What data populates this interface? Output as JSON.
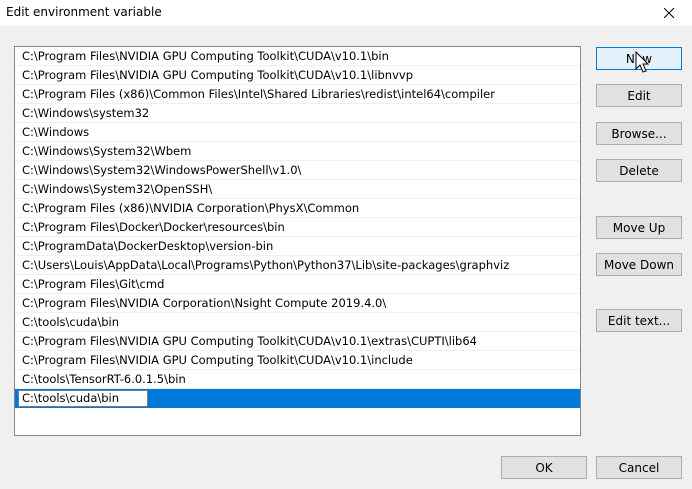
{
  "window": {
    "title": "Edit environment variable"
  },
  "entries": [
    "C:\\Program Files\\NVIDIA GPU Computing Toolkit\\CUDA\\v10.1\\bin",
    "C:\\Program Files\\NVIDIA GPU Computing Toolkit\\CUDA\\v10.1\\libnvvp",
    "C:\\Program Files (x86)\\Common Files\\Intel\\Shared Libraries\\redist\\intel64\\compiler",
    "C:\\Windows\\system32",
    "C:\\Windows",
    "C:\\Windows\\System32\\Wbem",
    "C:\\Windows\\System32\\WindowsPowerShell\\v1.0\\",
    "C:\\Windows\\System32\\OpenSSH\\",
    "C:\\Program Files (x86)\\NVIDIA Corporation\\PhysX\\Common",
    "C:\\Program Files\\Docker\\Docker\\resources\\bin",
    "C:\\ProgramData\\DockerDesktop\\version-bin",
    "C:\\Users\\Louis\\AppData\\Local\\Programs\\Python\\Python37\\Lib\\site-packages\\graphviz",
    "C:\\Program Files\\Git\\cmd",
    "C:\\Program Files\\NVIDIA Corporation\\Nsight Compute 2019.4.0\\",
    "C:\\tools\\cuda\\bin",
    "C:\\Program Files\\NVIDIA GPU Computing Toolkit\\CUDA\\v10.1\\extras\\CUPTI\\lib64",
    "C:\\Program Files\\NVIDIA GPU Computing Toolkit\\CUDA\\v10.1\\include",
    "C:\\tools\\TensorRT-6.0.1.5\\bin"
  ],
  "editing_entry": {
    "value": "C:\\tools\\cuda\\bin"
  },
  "buttons": {
    "new": "New",
    "edit": "Edit",
    "browse": "Browse...",
    "delete": "Delete",
    "move_up": "Move Up",
    "move_down": "Move Down",
    "edit_text": "Edit text...",
    "ok": "OK",
    "cancel": "Cancel"
  },
  "colors": {
    "selection": "#0078d7",
    "background": "#f0f0f0"
  },
  "icons": {
    "close": "close-icon",
    "cursor": "mouse-pointer-icon"
  }
}
